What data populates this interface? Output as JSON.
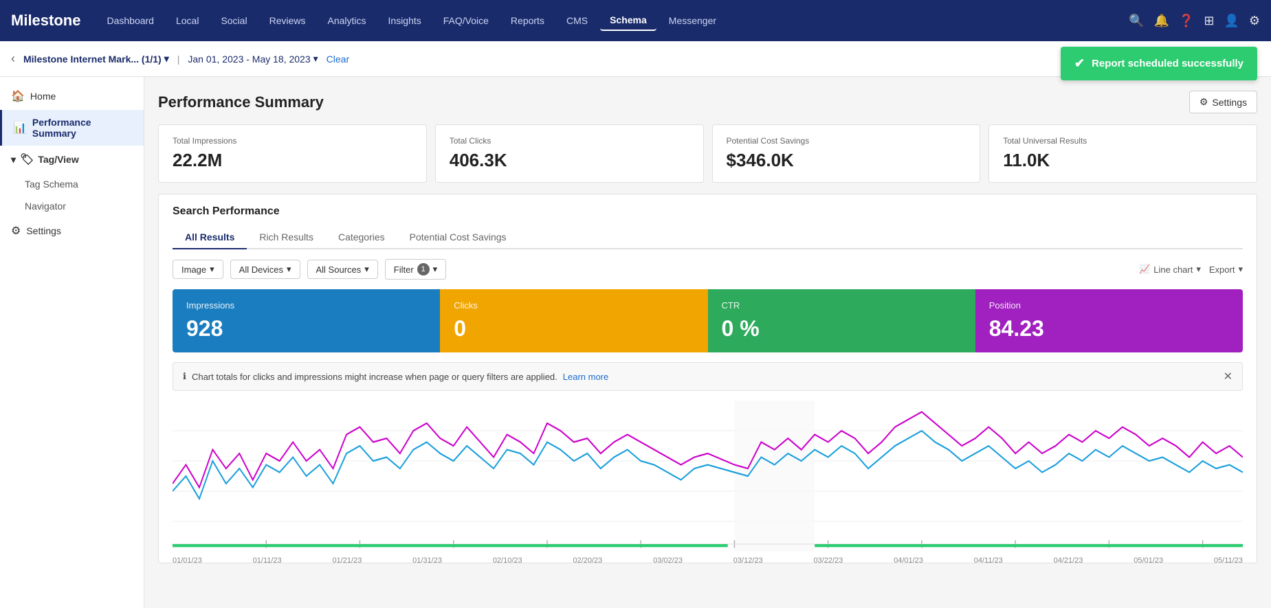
{
  "brand": {
    "name_part1": "Milestone",
    "logo_text": "Milestone"
  },
  "topnav": {
    "links": [
      {
        "label": "Dashboard",
        "active": false
      },
      {
        "label": "Local",
        "active": false
      },
      {
        "label": "Social",
        "active": false
      },
      {
        "label": "Reviews",
        "active": false
      },
      {
        "label": "Analytics",
        "active": false
      },
      {
        "label": "Insights",
        "active": false
      },
      {
        "label": "FAQ/Voice",
        "active": false
      },
      {
        "label": "Reports",
        "active": false
      },
      {
        "label": "CMS",
        "active": false
      },
      {
        "label": "Schema",
        "active": true
      },
      {
        "label": "Messenger",
        "active": false
      }
    ]
  },
  "breadcrumb": {
    "back_label": "‹",
    "location": "Milestone Internet Mark... (1/1)",
    "date_range": "Jan 01, 2023 - May 18, 2023",
    "clear_label": "Clear"
  },
  "toast": {
    "message": "Report scheduled successfully"
  },
  "sidebar": {
    "home_label": "Home",
    "performance_label": "Performance Summary",
    "tag_view_label": "Tag/View",
    "tag_schema_label": "Tag Schema",
    "navigator_label": "Navigator",
    "settings_label": "Settings"
  },
  "page": {
    "title": "Performance Summary",
    "settings_label": "Settings"
  },
  "stats": [
    {
      "label": "Total Impressions",
      "value": "22.2M"
    },
    {
      "label": "Total Clicks",
      "value": "406.3K"
    },
    {
      "label": "Potential Cost Savings",
      "value": "$346.0K"
    },
    {
      "label": "Total Universal Results",
      "value": "11.0K"
    }
  ],
  "search_performance": {
    "title": "Search Performance",
    "tabs": [
      {
        "label": "All Results",
        "active": true
      },
      {
        "label": "Rich Results",
        "active": false
      },
      {
        "label": "Categories",
        "active": false
      },
      {
        "label": "Potential Cost Savings",
        "active": false
      }
    ],
    "filters": {
      "type_label": "Image",
      "devices_label": "All Devices",
      "sources_label": "All Sources",
      "filter_label": "Filter",
      "filter_count": "1",
      "chart_type_label": "Line chart",
      "export_label": "Export"
    },
    "metrics": [
      {
        "label": "Impressions",
        "value": "928",
        "type": "impressions"
      },
      {
        "label": "Clicks",
        "value": "0",
        "type": "clicks"
      },
      {
        "label": "CTR",
        "value": "0 %",
        "type": "ctr"
      },
      {
        "label": "Position",
        "value": "84.23",
        "type": "position"
      }
    ],
    "info_bar": {
      "text": "Chart totals for clicks and impressions might increase when page or query filters are applied.",
      "link_label": "Learn more"
    },
    "chart": {
      "x_labels": [
        "01/01/23",
        "01/11/23",
        "01/21/23",
        "01/31/23",
        "02/10/23",
        "02/20/23",
        "03/02/23",
        "03/12/23",
        "03/22/23",
        "04/01/23",
        "04/11/23",
        "04/21/23",
        "05/01/23",
        "05/11/23"
      ]
    }
  }
}
